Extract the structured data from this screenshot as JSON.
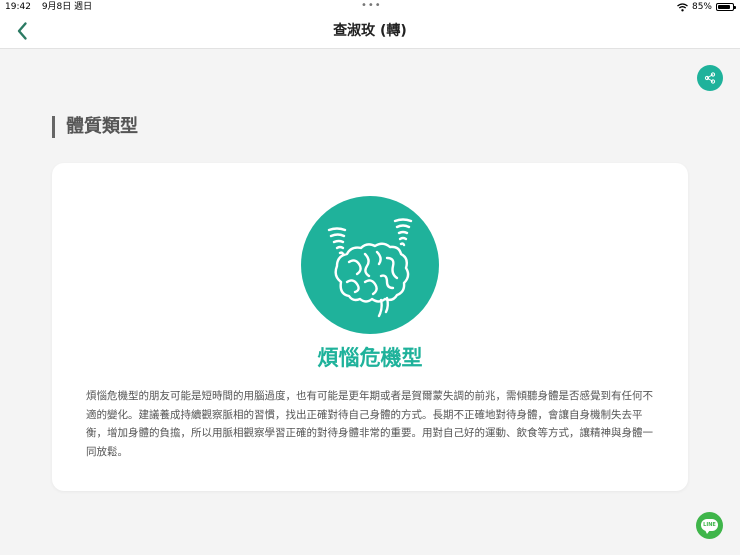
{
  "status_bar": {
    "time": "19:42",
    "date": "9月8日 週日",
    "battery": "85%",
    "battery_level": 0.85
  },
  "nav": {
    "title": "查淑玫 (轉)"
  },
  "section": {
    "title": "體質類型"
  },
  "result": {
    "type_name": "煩惱危機型",
    "description": "煩惱危機型的朋友可能是短時間的用腦過度，也有可能是更年期或者是賀爾蒙失調的前兆，需傾聽身體是否感覺到有任何不適的變化。建議養成持續觀察脈相的習慣，找出正確對待自己身體的方式。長期不正確地對待身體，會讓自身機制失去平衡，增加身體的負擔，所以用脈相觀察學習正確的對待身體非常的重要。用對自己好的運動、飲食等方式，讓精神與身體一同放鬆。"
  },
  "floating": {
    "line_label": "LINE"
  },
  "colors": {
    "accent": "#1fb29b",
    "line_green": "#3fb54a",
    "background": "#f4f4f4"
  },
  "icons": {
    "back": "chevron-left-icon",
    "share": "share-icon",
    "type": "brain-tornado-icon",
    "line": "line-chat-icon"
  }
}
